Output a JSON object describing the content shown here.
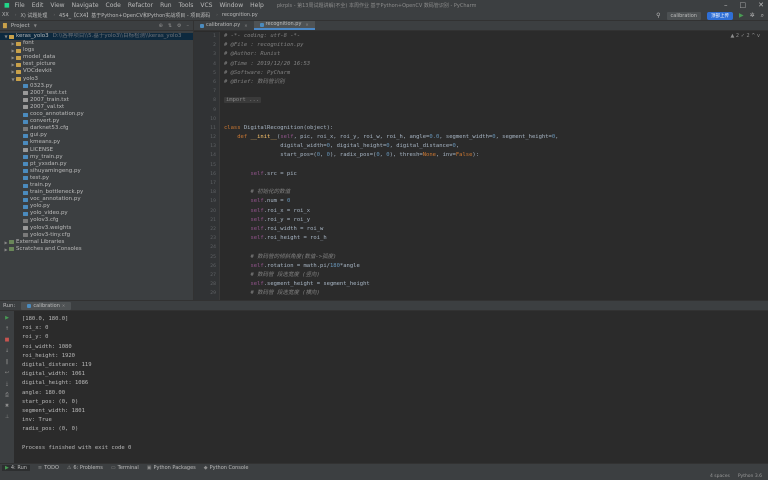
{
  "menubar": {
    "items": [
      "File",
      "Edit",
      "View",
      "Navigate",
      "Code",
      "Refactor",
      "Run",
      "Tools",
      "VCS",
      "Window",
      "Help"
    ],
    "window_title": "pkrpls - 第13周试题讲解(不全) 本周作业 基于Python+OpenCV 数码管识别 - PyCharm"
  },
  "navbar": {
    "crumbs": [
      "XX",
      "X) 试题处理",
      "454_【CX4】基于Python+OpenCV和Python实战项目 - 项目源码",
      "recognition.py"
    ],
    "run_config": "calibration",
    "cloud_badge": "顶部上传"
  },
  "project": {
    "header_label": "Project",
    "tree": [
      {
        "label": "keras_yolo3",
        "suffix": "D:\\\\各种项目\\\\5.基于yolo3\\\\目标检测\\\\keras_yolo3",
        "kind": "folder",
        "depth": 0,
        "open": true
      },
      {
        "label": "font",
        "kind": "folder",
        "depth": 1,
        "open": false
      },
      {
        "label": "logs",
        "kind": "folder",
        "depth": 1,
        "open": false
      },
      {
        "label": "model_data",
        "kind": "folder",
        "depth": 1,
        "open": false
      },
      {
        "label": "test_picture",
        "kind": "folder",
        "depth": 1,
        "open": false
      },
      {
        "label": "VOCdevkit",
        "kind": "folder",
        "depth": 1,
        "open": false
      },
      {
        "label": "yolo3",
        "kind": "folder",
        "depth": 1,
        "open": true
      },
      {
        "label": "0323.py",
        "kind": "py",
        "depth": 2
      },
      {
        "label": "2007_test.txt",
        "kind": "txt",
        "depth": 2
      },
      {
        "label": "2007_train.txt",
        "kind": "txt",
        "depth": 2
      },
      {
        "label": "2007_val.txt",
        "kind": "txt",
        "depth": 2
      },
      {
        "label": "coco_annotation.py",
        "kind": "py",
        "depth": 2
      },
      {
        "label": "convert.py",
        "kind": "py",
        "depth": 2
      },
      {
        "label": "darknet53.cfg",
        "kind": "cfg",
        "depth": 2
      },
      {
        "label": "gui.py",
        "kind": "py",
        "depth": 2
      },
      {
        "label": "kmeans.py",
        "kind": "py",
        "depth": 2
      },
      {
        "label": "LICENSE",
        "kind": "txt",
        "depth": 2
      },
      {
        "label": "my_train.py",
        "kind": "py",
        "depth": 2
      },
      {
        "label": "pt_yxsdan.py",
        "kind": "py",
        "depth": 2
      },
      {
        "label": "sihuyamingeng.py",
        "kind": "py",
        "depth": 2
      },
      {
        "label": "test.py",
        "kind": "py",
        "depth": 2
      },
      {
        "label": "train.py",
        "kind": "py",
        "depth": 2
      },
      {
        "label": "train_bottleneck.py",
        "kind": "py",
        "depth": 2
      },
      {
        "label": "voc_annotation.py",
        "kind": "py",
        "depth": 2
      },
      {
        "label": "yolo.py",
        "kind": "py",
        "depth": 2
      },
      {
        "label": "yolo_video.py",
        "kind": "py",
        "depth": 2
      },
      {
        "label": "yolov3.cfg",
        "kind": "cfg",
        "depth": 2
      },
      {
        "label": "yolov3.weights",
        "kind": "txt",
        "depth": 2
      },
      {
        "label": "yolov3-tiny.cfg",
        "kind": "cfg",
        "depth": 2
      },
      {
        "label": "External Libraries",
        "kind": "lib",
        "depth": 0,
        "open": false
      },
      {
        "label": "Scratches and Consoles",
        "kind": "lib",
        "depth": 0,
        "open": false
      }
    ]
  },
  "editor": {
    "tabs": [
      {
        "label": "calibration.py",
        "active": false
      },
      {
        "label": "recognition.py",
        "active": true
      }
    ],
    "status": "▲ 2  ✓ 2  ^  v",
    "lines": [
      [
        {
          "t": "# -*- coding: utf-8 -*-",
          "c": "cm"
        }
      ],
      [
        {
          "t": "# @File : recognition.py",
          "c": "cm"
        }
      ],
      [
        {
          "t": "# @Author: Runist",
          "c": "cm"
        }
      ],
      [
        {
          "t": "# @Time : 2019/12/20 16:53",
          "c": "cm"
        }
      ],
      [
        {
          "t": "# @Software: PyCharm",
          "c": "cm"
        }
      ],
      [
        {
          "t": "# @Brief: 数码管识别",
          "c": "cm"
        }
      ],
      [
        {
          "t": "",
          "c": ""
        }
      ],
      [
        {
          "t": "import ...",
          "c": "fold"
        }
      ],
      [
        {
          "t": "",
          "c": ""
        }
      ],
      [
        {
          "t": "",
          "c": ""
        }
      ],
      [
        {
          "t": "class ",
          "c": "kw"
        },
        {
          "t": "DigitalRecognition(object):",
          "c": ""
        }
      ],
      [
        {
          "t": "    def ",
          "c": "kw"
        },
        {
          "t": "__init__",
          "c": "fn"
        },
        {
          "t": "(",
          "c": ""
        },
        {
          "t": "self",
          "c": "self"
        },
        {
          "t": ", pic, roi_x, roi_y, roi_w, roi_h, angle=",
          "c": ""
        },
        {
          "t": "0.0",
          "c": "num"
        },
        {
          "t": ", segment_width=",
          "c": ""
        },
        {
          "t": "0",
          "c": "num"
        },
        {
          "t": ", segment_height=",
          "c": ""
        },
        {
          "t": "0",
          "c": "num"
        },
        {
          "t": ",",
          "c": ""
        }
      ],
      [
        {
          "t": "                 digital_width=",
          "c": ""
        },
        {
          "t": "0",
          "c": "num"
        },
        {
          "t": ", digital_height=",
          "c": ""
        },
        {
          "t": "0",
          "c": "num"
        },
        {
          "t": ", digital_distance=",
          "c": ""
        },
        {
          "t": "0",
          "c": "num"
        },
        {
          "t": ",",
          "c": ""
        }
      ],
      [
        {
          "t": "                 start_pos=(",
          "c": ""
        },
        {
          "t": "0",
          "c": "num"
        },
        {
          "t": ", ",
          "c": ""
        },
        {
          "t": "0",
          "c": "num"
        },
        {
          "t": "), radix_pos=(",
          "c": ""
        },
        {
          "t": "0",
          "c": "num"
        },
        {
          "t": ", ",
          "c": ""
        },
        {
          "t": "0",
          "c": "num"
        },
        {
          "t": "), thresh=",
          "c": ""
        },
        {
          "t": "None",
          "c": "kw"
        },
        {
          "t": ", inv=",
          "c": ""
        },
        {
          "t": "False",
          "c": "kw"
        },
        {
          "t": "):",
          "c": ""
        }
      ],
      [
        {
          "t": "",
          "c": ""
        }
      ],
      [
        {
          "t": "        ",
          "c": ""
        },
        {
          "t": "self",
          "c": "self"
        },
        {
          "t": ".src = pic",
          "c": ""
        }
      ],
      [
        {
          "t": "",
          "c": ""
        }
      ],
      [
        {
          "t": "        # 初始化的数值",
          "c": "cm"
        }
      ],
      [
        {
          "t": "        ",
          "c": ""
        },
        {
          "t": "self",
          "c": "self"
        },
        {
          "t": ".num = ",
          "c": ""
        },
        {
          "t": "0",
          "c": "num"
        }
      ],
      [
        {
          "t": "        ",
          "c": ""
        },
        {
          "t": "self",
          "c": "self"
        },
        {
          "t": ".roi_x = roi_x",
          "c": ""
        }
      ],
      [
        {
          "t": "        ",
          "c": ""
        },
        {
          "t": "self",
          "c": "self"
        },
        {
          "t": ".roi_y = roi_y",
          "c": ""
        }
      ],
      [
        {
          "t": "        ",
          "c": ""
        },
        {
          "t": "self",
          "c": "self"
        },
        {
          "t": ".roi_width = roi_w",
          "c": ""
        }
      ],
      [
        {
          "t": "        ",
          "c": ""
        },
        {
          "t": "self",
          "c": "self"
        },
        {
          "t": ".roi_height = roi_h",
          "c": ""
        }
      ],
      [
        {
          "t": "",
          "c": ""
        }
      ],
      [
        {
          "t": "        # 数码管的倾斜角度(数值->弧度)",
          "c": "cm"
        }
      ],
      [
        {
          "t": "        ",
          "c": ""
        },
        {
          "t": "self",
          "c": "self"
        },
        {
          "t": ".rotation = math.pi/",
          "c": ""
        },
        {
          "t": "180",
          "c": "num"
        },
        {
          "t": "*angle",
          "c": ""
        }
      ],
      [
        {
          "t": "        # 数码管 段选宽度 (竖向)",
          "c": "cm"
        }
      ],
      [
        {
          "t": "        ",
          "c": ""
        },
        {
          "t": "self",
          "c": "self"
        },
        {
          "t": ".segment_height = segment_height",
          "c": ""
        }
      ],
      [
        {
          "t": "        # 数码管 段选宽度 (横向)",
          "c": "cm"
        }
      ]
    ]
  },
  "run": {
    "header_label": "Run:",
    "tab_label": "calibration",
    "console": [
      "[180.0, 180.0]",
      "roi_x: 0",
      "roi_y: 0",
      "roi_width: 1080",
      "roi_height: 1920",
      "digital_distance: 119",
      "digital_width: 1061",
      "digital_height: 1086",
      "angle: 180.00",
      "start_pos: (0, 0)",
      "segment_width: 1801",
      "inv: True",
      "radix_pos: (0, 0)",
      "",
      "Process finished with exit code 0"
    ]
  },
  "toolwindows": [
    {
      "label": "4: Run",
      "icon": "play-icon",
      "active": true
    },
    {
      "label": "TODO",
      "icon": "list-icon",
      "active": false
    },
    {
      "label": "6: Problems",
      "icon": "warning-icon",
      "active": false
    },
    {
      "label": "Terminal",
      "icon": "terminal-icon",
      "active": false
    },
    {
      "label": "Python Packages",
      "icon": "package-icon",
      "active": false
    },
    {
      "label": "Python Console",
      "icon": "python-icon",
      "active": false
    }
  ],
  "statusbar": {
    "items": [
      "4 spaces",
      "Python 3.6"
    ]
  },
  "colors": {
    "bg": "#2b2b2b",
    "panel": "#3c3f41",
    "accent": "#4a88c7",
    "keyword": "#cc7832",
    "comment": "#808080"
  }
}
